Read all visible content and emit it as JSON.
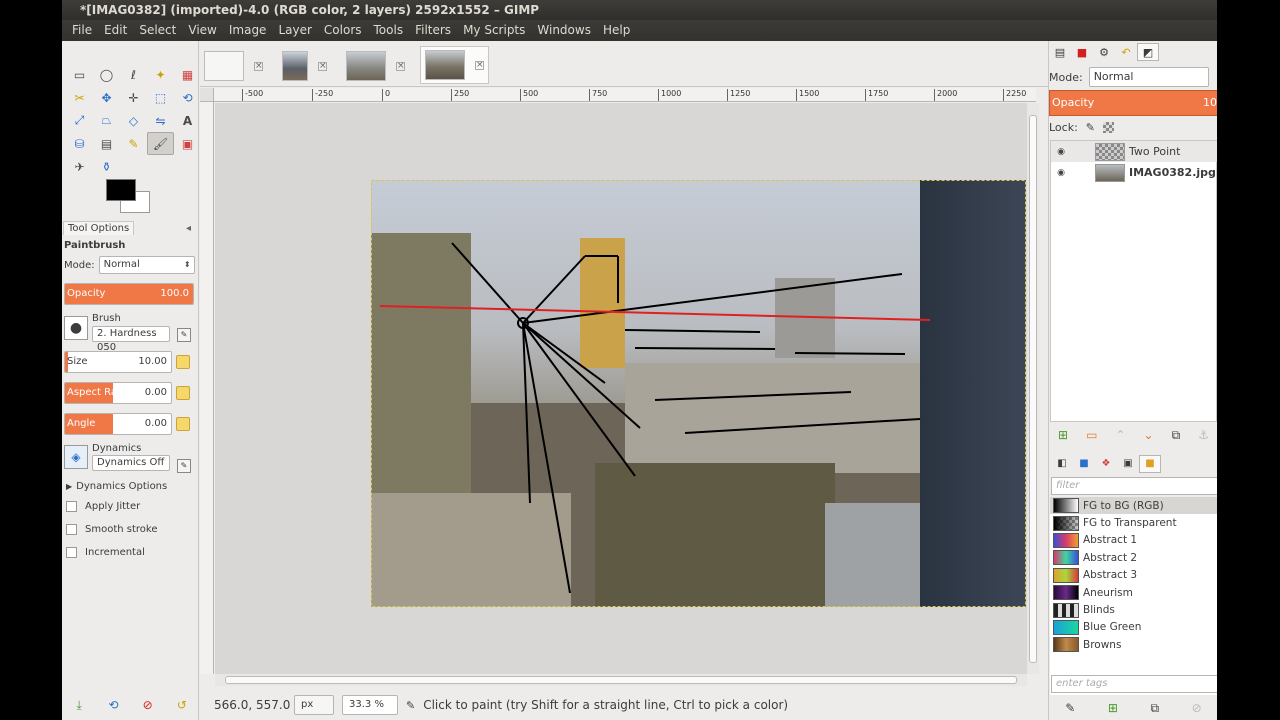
{
  "window": {
    "title": "*[IMAG0382] (imported)-4.0 (RGB color, 2 layers) 2592x1552 – GIMP"
  },
  "menu": [
    "File",
    "Edit",
    "Select",
    "View",
    "Image",
    "Layer",
    "Colors",
    "Tools",
    "Filters",
    "My Scripts",
    "Windows",
    "Help"
  ],
  "tool_options": {
    "tab_label": "Tool Options",
    "tool_name": "Paintbrush",
    "mode_label": "Mode:",
    "mode_value": "Normal",
    "opacity_label": "Opacity",
    "opacity_value": "100.0",
    "brush_label": "Brush",
    "brush_value": "2. Hardness 050",
    "size_label": "Size",
    "size_value": "10.00",
    "aspect_label": "Aspect Ra...",
    "aspect_value": "0.00",
    "angle_label": "Angle",
    "angle_value": "0.00",
    "dynamics_label": "Dynamics",
    "dynamics_value": "Dynamics Off",
    "dynamics_options": "Dynamics Options",
    "apply_jitter": "Apply Jitter",
    "smooth_stroke": "Smooth stroke",
    "incremental": "Incremental"
  },
  "ruler_ticks": [
    "-500",
    "-250",
    "0",
    "250",
    "500",
    "750",
    "1000",
    "1250",
    "1500",
    "1750",
    "2000",
    "2250"
  ],
  "status": {
    "coords": "566.0, 557.0",
    "unit": "px",
    "zoom": "33.3 %",
    "message": "Click to paint (try Shift for a straight line, Ctrl to pick a color)"
  },
  "layers_panel": {
    "mode_label": "Mode:",
    "mode_value": "Normal",
    "opacity_label": "Opacity",
    "opacity_value": "10",
    "lock_label": "Lock:",
    "layers": [
      {
        "name": "Two Point"
      },
      {
        "name": "IMAG0382.jpg"
      }
    ]
  },
  "gradients": {
    "filter_placeholder": "filter",
    "tags_placeholder": "enter tags",
    "items": [
      {
        "name": "FG to BG (RGB)",
        "color": "#000000"
      },
      {
        "name": "FG to Transparent",
        "color": "#333333"
      },
      {
        "name": "Abstract 1",
        "color": "#3b4fd8"
      },
      {
        "name": "Abstract 2",
        "color": "#d83b6a"
      },
      {
        "name": "Abstract 3",
        "color": "#a8d83b"
      },
      {
        "name": "Aneurism",
        "color": "#6a2a8a"
      },
      {
        "name": "Blinds",
        "color": "#888888"
      },
      {
        "name": "Blue Green",
        "color": "#1aa0d8"
      },
      {
        "name": "Browns",
        "color": "#8a5a2a"
      }
    ]
  },
  "colors": {
    "accent": "#f07746",
    "drawn_lines": "#000000",
    "horizon_line": "#e02020"
  }
}
